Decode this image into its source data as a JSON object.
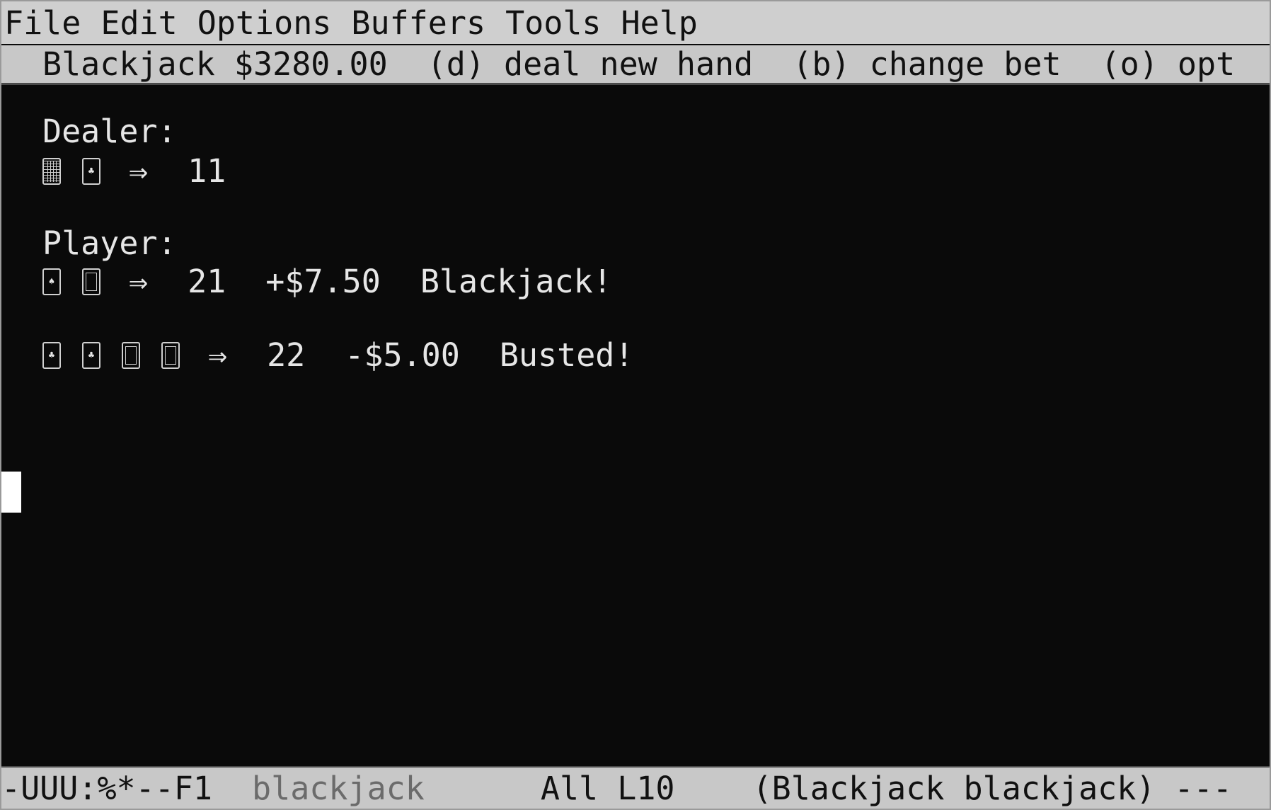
{
  "menubar": {
    "items": [
      "File",
      "Edit",
      "Options",
      "Buffers",
      "Tools",
      "Help"
    ]
  },
  "header": {
    "title": "Blackjack $3280.00",
    "deal": "(d) deal new hand",
    "bet": "(b) change bet",
    "options": "(o) opt"
  },
  "game": {
    "dealer_label": "Dealer:",
    "dealer_hand": {
      "cards": [
        "card-back",
        "club-card"
      ],
      "arrow": "⇒",
      "total": "11"
    },
    "player_label": "Player:",
    "player_hands": [
      {
        "cards": [
          "spade-card",
          "king-card"
        ],
        "arrow": "⇒",
        "total": "21",
        "amount": "+$7.50",
        "result": "Blackjack!"
      },
      {
        "cards": [
          "club-card",
          "club-card",
          "jack-card",
          "queen-card"
        ],
        "arrow": "⇒",
        "total": "22",
        "amount": "-$5.00",
        "result": "Busted!"
      }
    ]
  },
  "modeline": {
    "status": "-UUU:%*--F1",
    "buffer": "blackjack",
    "position": "All L10",
    "modes": "(Blackjack blackjack) ---"
  }
}
